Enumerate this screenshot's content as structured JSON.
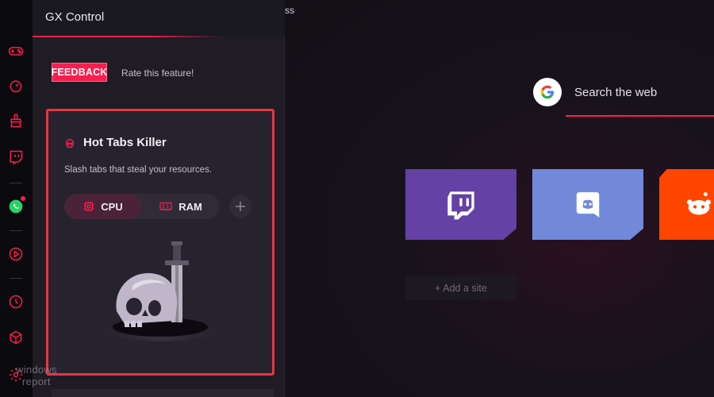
{
  "colors": {
    "accent": "#fa1e4e",
    "panel_bg": "#1f1c26",
    "rail_bg": "#0b0a0e",
    "twitch": "#6441a4",
    "discord": "#7289da",
    "reddit": "#ff4500"
  },
  "rail": {
    "icons": [
      "gamepad-icon",
      "speedometer-icon",
      "broom-icon",
      "twitch-icon",
      "whatsapp-icon",
      "player-icon",
      "clock-icon",
      "box-icon",
      "gear-icon"
    ],
    "whatsapp_has_notification": true
  },
  "panel": {
    "title": "GX Control",
    "feedback_label": "FEEDBACK",
    "feedback_prompt": "Rate this feature!",
    "card": {
      "title": "Hot Tabs Killer",
      "description": "Slash tabs that steal your resources.",
      "toggle_cpu": "CPU",
      "toggle_ram": "RAM",
      "selected": "CPU"
    }
  },
  "speed_dial": {
    "tab_fragment": "ss",
    "search_label": "Search the web",
    "tiles": [
      {
        "name": "Twitch",
        "icon": "twitch-icon"
      },
      {
        "name": "Discord",
        "icon": "discord-icon"
      },
      {
        "name": "Reddit",
        "icon": "reddit-icon"
      }
    ],
    "add_site_label": "+ Add a site"
  },
  "watermark": {
    "line1": "windows",
    "line2": "report"
  }
}
